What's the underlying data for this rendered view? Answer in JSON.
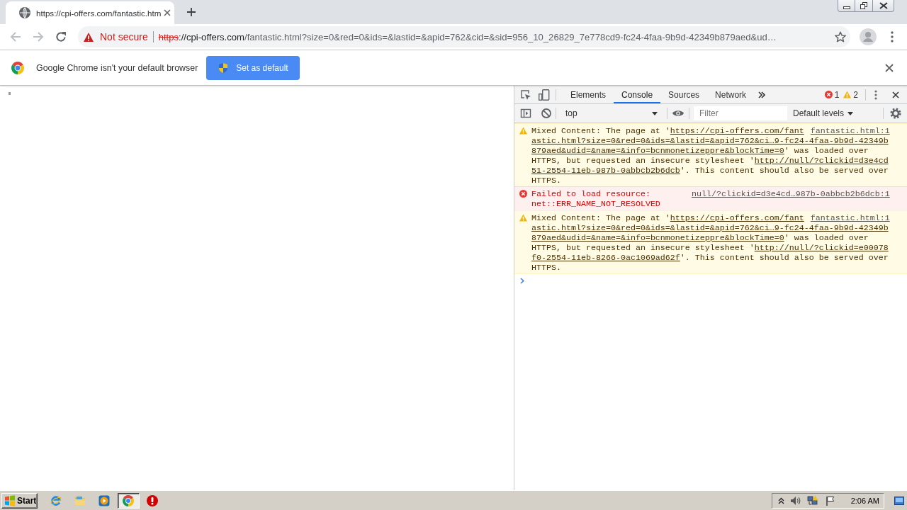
{
  "tabs": [
    {
      "title": "https://cpi-offers.com/fantastic.htm",
      "selected": true
    }
  ],
  "toolbar": {
    "back": {
      "disabled": true
    },
    "forward": {
      "disabled": true
    }
  },
  "address_bar": {
    "security_label": "Not secure",
    "url": [
      {
        "text": "https",
        "kind": "scheme"
      },
      {
        "text": "://cpi-offers.com",
        "kind": "host"
      },
      {
        "text": "/fantastic.html?size=0&red=0&ids=&lastid=&apid=762&cid=&sid=956_10_26829_7e778cd9-fc24-4faa-9b9d-42349b879aed&ud…",
        "kind": "path"
      }
    ]
  },
  "infobar": {
    "message": "Google Chrome isn't your default browser",
    "button": "Set as default"
  },
  "devtools": {
    "tabs": [
      {
        "label": "Elements",
        "selected": false
      },
      {
        "label": "Console",
        "selected": true
      },
      {
        "label": "Sources",
        "selected": false
      },
      {
        "label": "Network",
        "selected": false
      }
    ],
    "error_count": "1",
    "warning_count": "2",
    "context": "top",
    "filter_placeholder": "Filter",
    "levels": "Default levels",
    "messages": [
      {
        "kind": "warning",
        "source": "fantastic.html:1",
        "lines": [
          [
            {
              "text": "Mixed Content: The page at '",
              "kind": "plain"
            },
            {
              "text": "https://cpi-offers.com/fant",
              "kind": "link"
            }
          ],
          [
            {
              "text": "astic.html?size=0&red=0&ids=&lastid=&apid=762&ci…9-fc24-4faa-9b9d-42349b",
              "kind": "link"
            }
          ],
          [
            {
              "text": "879aed&udid=&name=&info=bcnmonetizeppre&blockTime=0",
              "kind": "link"
            },
            {
              "text": "' was loaded over",
              "kind": "plain"
            }
          ],
          [
            {
              "text": "HTTPS, but requested an insecure stylesheet '",
              "kind": "plain"
            },
            {
              "text": "http://null/?clickid=d3e4cd",
              "kind": "link"
            }
          ],
          [
            {
              "text": "51-2554-11eb-987b-0abbcb2b6dcb",
              "kind": "link"
            },
            {
              "text": "'. This content should also be served over",
              "kind": "plain"
            }
          ],
          [
            {
              "text": "HTTPS.",
              "kind": "plain"
            }
          ]
        ]
      },
      {
        "kind": "error",
        "source": "null/?clickid=d3e4cd…987b-0abbcb2b6dcb:1",
        "lines": [
          [
            {
              "text": "Failed to load resource:",
              "kind": "plain"
            }
          ],
          [
            {
              "text": "net::ERR_NAME_NOT_RESOLVED",
              "kind": "plain"
            }
          ]
        ]
      },
      {
        "kind": "warning",
        "source": "fantastic.html:1",
        "lines": [
          [
            {
              "text": "Mixed Content: The page at '",
              "kind": "plain"
            },
            {
              "text": "https://cpi-offers.com/fant",
              "kind": "link"
            }
          ],
          [
            {
              "text": "astic.html?size=0&red=0&ids=&lastid=&apid=762&ci…9-fc24-4faa-9b9d-42349b",
              "kind": "link"
            }
          ],
          [
            {
              "text": "879aed&udid=&name=&info=bcnmonetizeppre&blockTime=0",
              "kind": "link"
            },
            {
              "text": "' was loaded over",
              "kind": "plain"
            }
          ],
          [
            {
              "text": "HTTPS, but requested an insecure stylesheet '",
              "kind": "plain"
            },
            {
              "text": "http://null/?clickid=e00078",
              "kind": "link"
            }
          ],
          [
            {
              "text": "f0-2554-11eb-8266-0ac1069ad62f",
              "kind": "link"
            },
            {
              "text": "'. This content should also be served over",
              "kind": "plain"
            }
          ],
          [
            {
              "text": "HTTPS.",
              "kind": "plain"
            }
          ]
        ]
      }
    ]
  },
  "taskbar": {
    "start": "Start",
    "apps": [
      {
        "kind": "ie",
        "selected": false
      },
      {
        "kind": "folder",
        "selected": false
      },
      {
        "kind": "media",
        "selected": false
      },
      {
        "kind": "chrome",
        "selected": true
      },
      {
        "kind": "stop",
        "selected": false
      }
    ],
    "clock": "2:06 AM"
  }
}
